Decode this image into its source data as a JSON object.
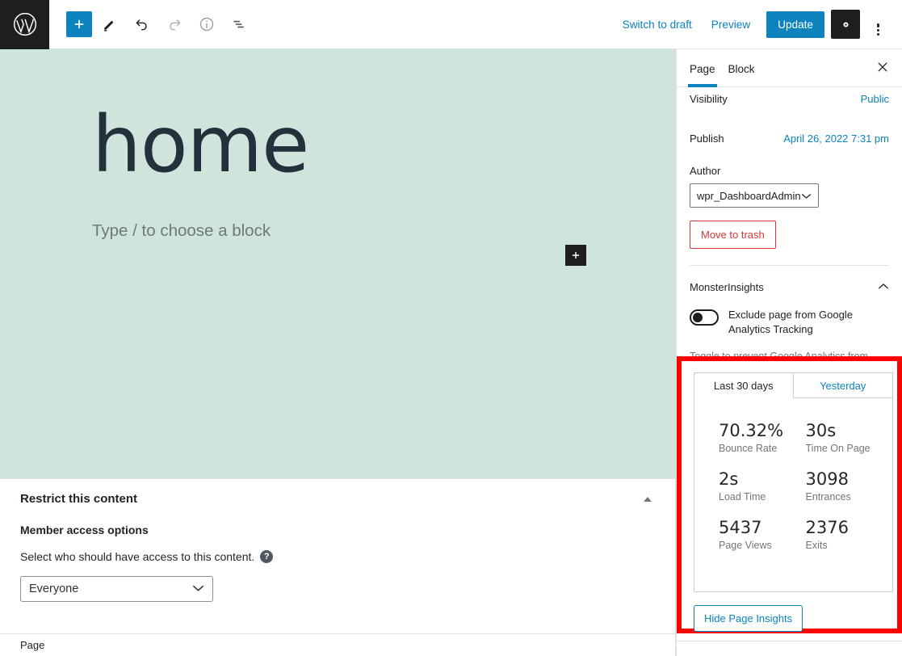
{
  "toolbar": {
    "logo_icon": "wordpress-logo-icon",
    "add_block_icon": "plus-icon",
    "edit_icon": "pencil-icon",
    "undo_icon": "undo-arrow-icon",
    "redo_icon": "redo-arrow-icon",
    "info_icon": "info-circle-icon",
    "list_view_icon": "list-view-icon",
    "switch_to_draft_label": "Switch to draft",
    "preview_label": "Preview",
    "update_label": "Update",
    "settings_icon": "gear-icon",
    "options_icon": "three-dots-vertical-icon",
    "accent_color": "#0c83bd"
  },
  "canvas": {
    "background_color": "#cfe5dc",
    "post_title": "home",
    "paragraph_placeholder": "Type / to choose a block",
    "inserter_icon": "plus-icon"
  },
  "meta_box": {
    "title": "Restrict this content",
    "collapse_icon": "triangle-up-icon",
    "subtitle": "Member access options",
    "description": "Select who should have access to this content.",
    "help_icon": "question-mark-icon",
    "select_value": "Everyone",
    "select_chevron_icon": "chevron-down-icon",
    "select_options": [
      "Everyone"
    ]
  },
  "status_bar": {
    "breadcrumb": "Page"
  },
  "sidebar": {
    "tabs": [
      {
        "label": "Page",
        "active": true
      },
      {
        "label": "Block",
        "active": false
      }
    ],
    "close_icon": "close-icon",
    "page_panel": {
      "visibility_label": "Visibility",
      "visibility_value": "Public",
      "publish_label": "Publish",
      "publish_value": "April 26, 2022 7:31 pm",
      "author_label": "Author",
      "author_value": "wpr_DashboardAdmin",
      "author_chevron_icon": "chevron-down-icon",
      "trash_label": "Move to trash",
      "trash_color": "#d63638"
    },
    "monsterinsights": {
      "panel_title": "MonsterInsights",
      "collapse_icon": "chevron-up-icon",
      "toggle_label": "Exclude page from Google Analytics Tracking",
      "toggle_state": "off",
      "help_text": "Toggle to prevent Google Analytics from tracking this page."
    },
    "page_insights": {
      "highlight_color": "#ff0000",
      "tabs": [
        {
          "label": "Last 30 days",
          "active": true
        },
        {
          "label": "Yesterday",
          "active": false
        }
      ],
      "stats": [
        {
          "value": "70.32%",
          "label": "Bounce Rate"
        },
        {
          "value": "30s",
          "label": "Time On Page"
        },
        {
          "value": "2s",
          "label": "Load Time"
        },
        {
          "value": "3098",
          "label": "Entrances"
        },
        {
          "value": "5437",
          "label": "Page Views"
        },
        {
          "value": "2376",
          "label": "Exits"
        }
      ],
      "hide_button_label": "Hide Page Insights"
    }
  }
}
